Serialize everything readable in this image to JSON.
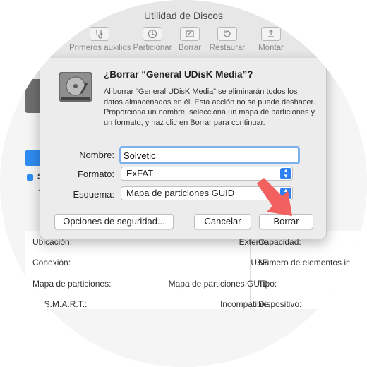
{
  "window": {
    "title": "Utilidad de Discos"
  },
  "toolbar": {
    "items": [
      {
        "label": "Primeros auxilios",
        "icon": "stethoscope-icon"
      },
      {
        "label": "Particionar",
        "icon": "pie-chart-icon"
      },
      {
        "label": "Borrar",
        "icon": "erase-icon"
      },
      {
        "label": "Restaurar",
        "icon": "restore-icon"
      },
      {
        "label": "Montar",
        "icon": "mount-icon"
      }
    ]
  },
  "dialog": {
    "title": "¿Borrar “General UDisK Media”?",
    "message": "Al borrar “General UDisK Media” se eliminarán todos los datos almacenados en él. Esta acción no se puede deshacer. Proporciona un nombre, selecciona un mapa de particiones y un formato, y haz clic en Borrar para continuar.",
    "name_label": "Nombre:",
    "name_value": "Solvetic",
    "format_label": "Formato:",
    "format_value": "ExFAT",
    "scheme_label": "Esquema:",
    "scheme_value": "Mapa de particiones GUID",
    "security_button": "Opciones de seguridad...",
    "cancel_button": "Cancelar",
    "erase_button": "Borrar"
  },
  "background": {
    "s_letter": "S",
    "one": "1",
    "info": {
      "rows": [
        {
          "label": "Ubicación:",
          "value": "Externo",
          "label2": "Capacidad:"
        },
        {
          "label": "Conexión:",
          "value": "USB",
          "label2": "Número de elementos in"
        },
        {
          "label": "Mapa de particiones:",
          "value": "Mapa de particiones GUID",
          "label2": "Tipo:"
        },
        {
          "label": "do S.M.A.R.T.:",
          "value": "Incompatible",
          "label2": "Dispositivo:"
        }
      ]
    }
  },
  "colors": {
    "accent": "#2d7ff2",
    "arrow": "#f26060",
    "focus_ring": "#7eb0ee"
  }
}
